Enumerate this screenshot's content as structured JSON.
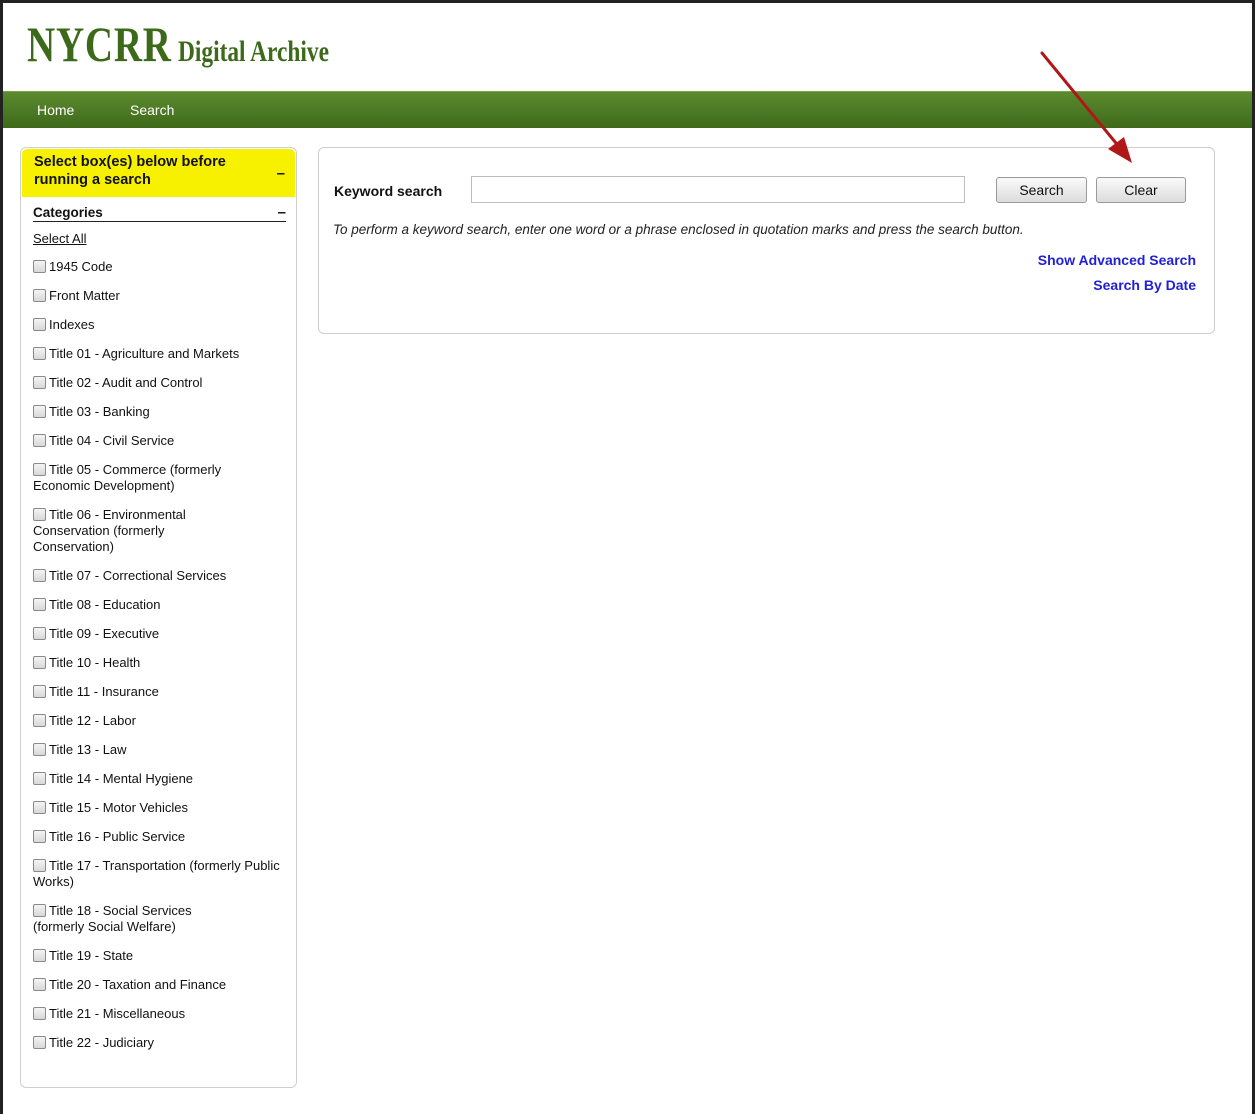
{
  "header": {
    "logo_main": "NYCRR",
    "logo_sub": "Digital Archive"
  },
  "nav": {
    "items": [
      {
        "label": "Home"
      },
      {
        "label": "Search"
      }
    ]
  },
  "sidebar": {
    "notice": "Select box(es) below before running a search",
    "collapse_symbol": "–",
    "categories_heading": "Categories",
    "select_all": "Select All",
    "items": [
      {
        "label": "1945 Code"
      },
      {
        "label": "Front Matter"
      },
      {
        "label": "Indexes"
      },
      {
        "label": "Title 01 - Agriculture and Markets"
      },
      {
        "label": "Title 02 - Audit and Control"
      },
      {
        "label": "Title 03 - Banking"
      },
      {
        "label": "Title 04 - Civil Service"
      },
      {
        "label": "Title 05 - Commerce (formerly Economic Development)"
      },
      {
        "label": "Title 06 - Environmental Conservation (formerly Conservation)"
      },
      {
        "label": "Title 07 - Correctional Services"
      },
      {
        "label": "Title 08 - Education"
      },
      {
        "label": "Title 09 - Executive"
      },
      {
        "label": "Title 10 - Health"
      },
      {
        "label": "Title 11 - Insurance"
      },
      {
        "label": "Title 12 - Labor"
      },
      {
        "label": "Title 13 - Law"
      },
      {
        "label": "Title 14 - Mental Hygiene"
      },
      {
        "label": "Title 15 - Motor Vehicles"
      },
      {
        "label": "Title 16 - Public Service"
      },
      {
        "label": "Title 17 - Transportation (formerly Public Works)"
      },
      {
        "label": "Title 18 - Social Services (formerly Social Welfare)"
      },
      {
        "label": "Title 19 - State"
      },
      {
        "label": "Title 20 - Taxation and Finance"
      },
      {
        "label": "Title 21 - Miscellaneous"
      },
      {
        "label": "Title 22 - Judiciary"
      }
    ]
  },
  "search": {
    "label": "Keyword search",
    "value": "",
    "placeholder": "",
    "search_button": "Search",
    "clear_button": "Clear",
    "instructions": "To perform a keyword search, enter one word or a phrase enclosed in quotation marks and press the search button.",
    "advanced_link": "Show Advanced Search",
    "date_link": "Search By Date"
  },
  "colors": {
    "brand_green": "#3d6a1a",
    "notice_yellow": "#f7f100",
    "link_blue": "#1f1fd6",
    "annotation_arrow": "#b01818"
  }
}
